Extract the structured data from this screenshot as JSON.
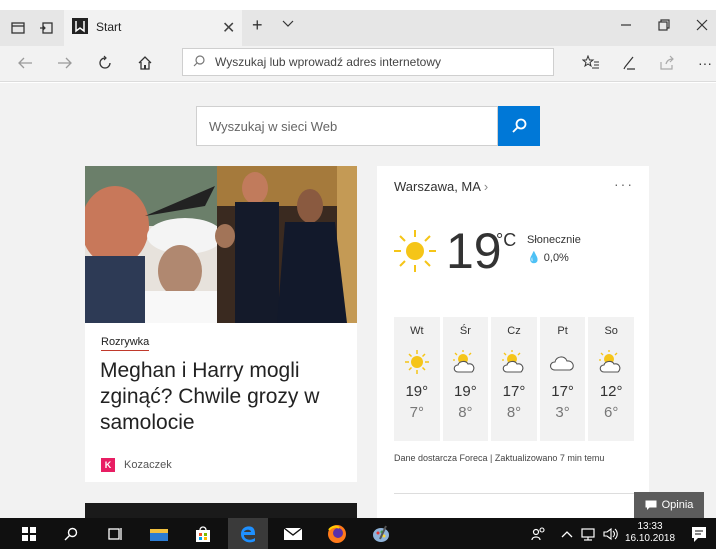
{
  "browser": {
    "tab_title": "Start",
    "address_placeholder": "Wyszukaj lub wprowadź adres internetowy",
    "new_tab_symbol": "+",
    "close_symbol": "✕"
  },
  "search": {
    "placeholder": "Wyszukaj w sieci Web"
  },
  "news": {
    "category": "Rozrywka",
    "headline": "Meghan i Harry mogli zginąć? Chwile grozy w samolocie",
    "source": "Kozaczek",
    "source_logo_letter": "K"
  },
  "weather": {
    "location": "Warszawa, MA",
    "temperature": "19",
    "unit": "°C",
    "condition": "Słonecznie",
    "precipitation": "0,0%",
    "forecast": [
      {
        "day": "Wt",
        "high": "19°",
        "low": "7°",
        "icon": "sunny-icon"
      },
      {
        "day": "Śr",
        "high": "19°",
        "low": "8°",
        "icon": "partly-cloudy-icon"
      },
      {
        "day": "Cz",
        "high": "17°",
        "low": "8°",
        "icon": "partly-cloudy-icon"
      },
      {
        "day": "Pt",
        "high": "17°",
        "low": "3°",
        "icon": "cloudy-icon"
      },
      {
        "day": "So",
        "high": "12°",
        "low": "6°",
        "icon": "partly-cloudy-icon"
      }
    ],
    "footer": "Dane dostarcza Foreca | Zaktualizowano 7 min temu",
    "more": "···"
  },
  "feedback": {
    "label": "Opinia"
  },
  "taskbar": {
    "time": "13:33",
    "date": "16.10.2018"
  },
  "colors": {
    "accent": "#0078d7",
    "taskbar": "#101010",
    "sun": "#f5c518"
  }
}
